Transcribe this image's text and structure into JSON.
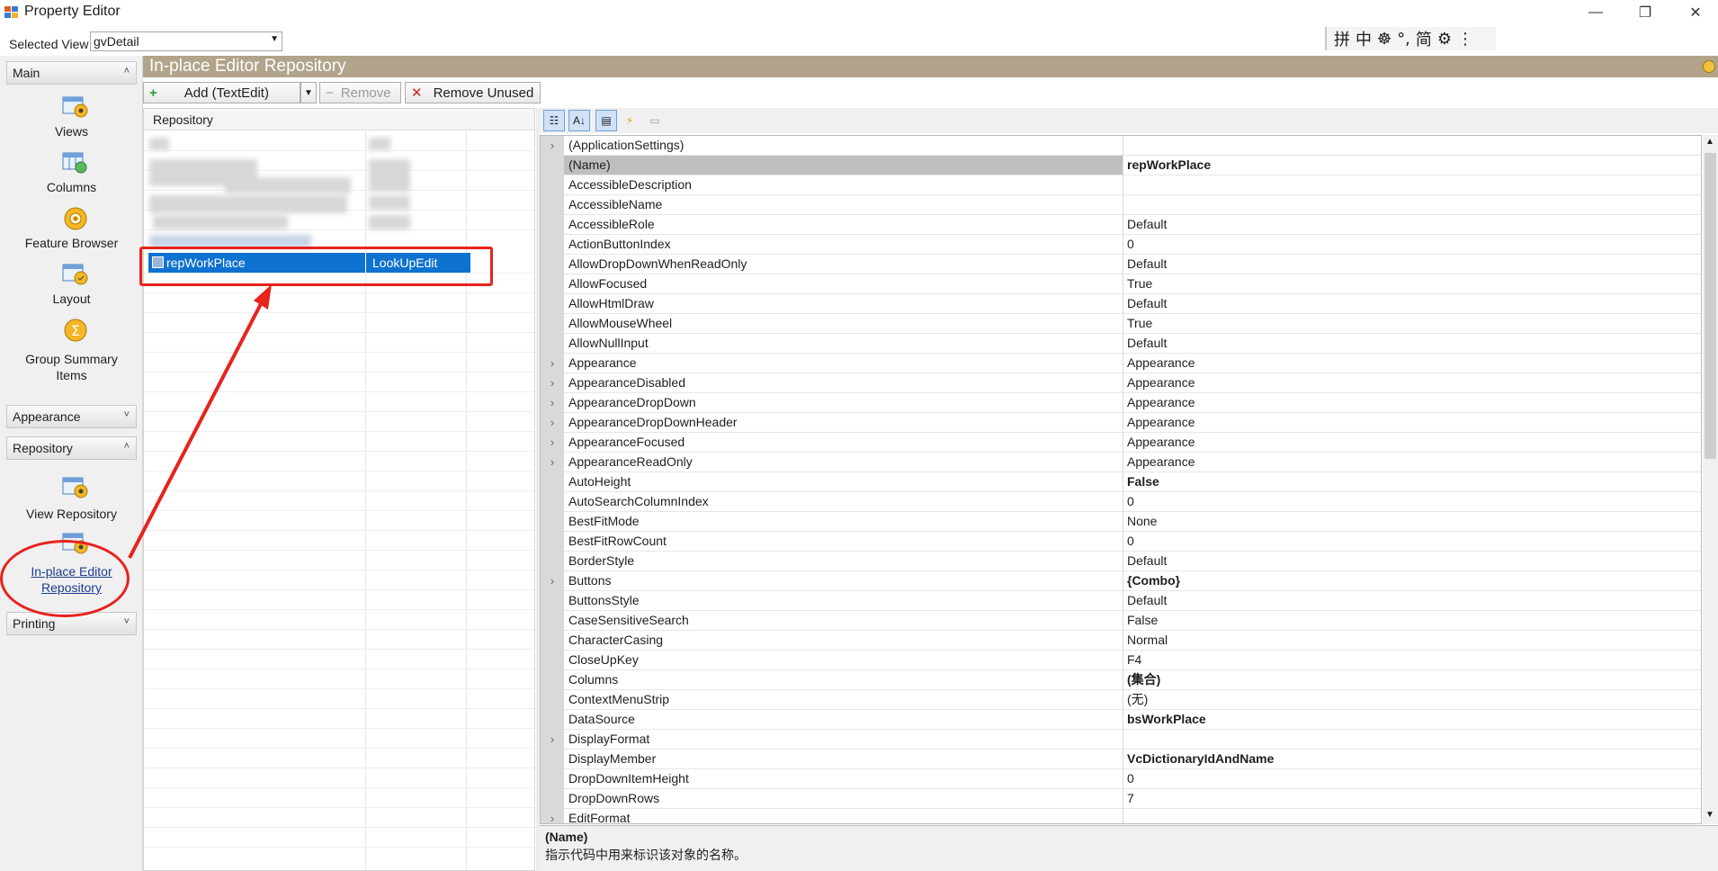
{
  "window": {
    "title": "Property Editor",
    "controls": [
      "—",
      "❐",
      "✕"
    ]
  },
  "selected_view": {
    "label": "Selected View",
    "value": "gvDetail"
  },
  "ime_toolbar": [
    "拼",
    "中",
    "☸",
    "°,",
    "简",
    "⚙",
    "⋮"
  ],
  "leftnav": {
    "groups": [
      {
        "label": "Main",
        "chevron": "˄"
      },
      {
        "label": "Appearance",
        "chevron": "˅"
      },
      {
        "label": "Repository",
        "chevron": "˄"
      },
      {
        "label": "Printing",
        "chevron": "˅"
      }
    ],
    "main_items": [
      "Views",
      "Columns",
      "Feature Browser",
      "Layout",
      "Group Summary Items"
    ],
    "repository_items": [
      "View Repository",
      "In-place Editor Repository"
    ]
  },
  "panel": {
    "title": "In-place Editor Repository"
  },
  "toolbar": {
    "add_label": "Add (TextEdit)",
    "remove_label": "Remove",
    "remove_unused_label": "Remove Unused"
  },
  "repository": {
    "header": "Repository",
    "selected_row": {
      "name": "repWorkPlace",
      "type": "LookUpEdit"
    }
  },
  "properties": [
    {
      "name": "(ApplicationSettings)",
      "value": "",
      "expand": true
    },
    {
      "name": "(Name)",
      "value": "repWorkPlace",
      "bold": true,
      "selected": true
    },
    {
      "name": "AccessibleDescription",
      "value": ""
    },
    {
      "name": "AccessibleName",
      "value": ""
    },
    {
      "name": "AccessibleRole",
      "value": "Default"
    },
    {
      "name": "ActionButtonIndex",
      "value": "0"
    },
    {
      "name": "AllowDropDownWhenReadOnly",
      "value": "Default"
    },
    {
      "name": "AllowFocused",
      "value": "True"
    },
    {
      "name": "AllowHtmlDraw",
      "value": "Default"
    },
    {
      "name": "AllowMouseWheel",
      "value": "True"
    },
    {
      "name": "AllowNullInput",
      "value": "Default"
    },
    {
      "name": "Appearance",
      "value": "Appearance",
      "expand": true
    },
    {
      "name": "AppearanceDisabled",
      "value": "Appearance",
      "expand": true
    },
    {
      "name": "AppearanceDropDown",
      "value": "Appearance",
      "expand": true
    },
    {
      "name": "AppearanceDropDownHeader",
      "value": "Appearance",
      "expand": true
    },
    {
      "name": "AppearanceFocused",
      "value": "Appearance",
      "expand": true
    },
    {
      "name": "AppearanceReadOnly",
      "value": "Appearance",
      "expand": true
    },
    {
      "name": "AutoHeight",
      "value": "False",
      "bold": true
    },
    {
      "name": "AutoSearchColumnIndex",
      "value": "0"
    },
    {
      "name": "BestFitMode",
      "value": "None"
    },
    {
      "name": "BestFitRowCount",
      "value": "0"
    },
    {
      "name": "BorderStyle",
      "value": "Default"
    },
    {
      "name": "Buttons",
      "value": "{Combo}",
      "bold": true,
      "expand": true
    },
    {
      "name": "ButtonsStyle",
      "value": "Default"
    },
    {
      "name": "CaseSensitiveSearch",
      "value": "False"
    },
    {
      "name": "CharacterCasing",
      "value": "Normal"
    },
    {
      "name": "CloseUpKey",
      "value": "F4"
    },
    {
      "name": "Columns",
      "value": "(集合)",
      "bold": true
    },
    {
      "name": "ContextMenuStrip",
      "value": "(无)"
    },
    {
      "name": "DataSource",
      "value": "bsWorkPlace",
      "bold": true
    },
    {
      "name": "DisplayFormat",
      "value": "",
      "expand": true
    },
    {
      "name": "DisplayMember",
      "value": "VcDictionaryIdAndName",
      "bold": true
    },
    {
      "name": "DropDownItemHeight",
      "value": "0"
    },
    {
      "name": "DropDownRows",
      "value": "7"
    },
    {
      "name": "EditFormat",
      "value": "",
      "expand": true
    }
  ],
  "description": {
    "title": "(Name)",
    "text": "指示代码中用来标识该对象的名称。"
  },
  "colors": {
    "header": "#b2a48a",
    "selection": "#0e72d0",
    "annotation": "#e8221d"
  }
}
